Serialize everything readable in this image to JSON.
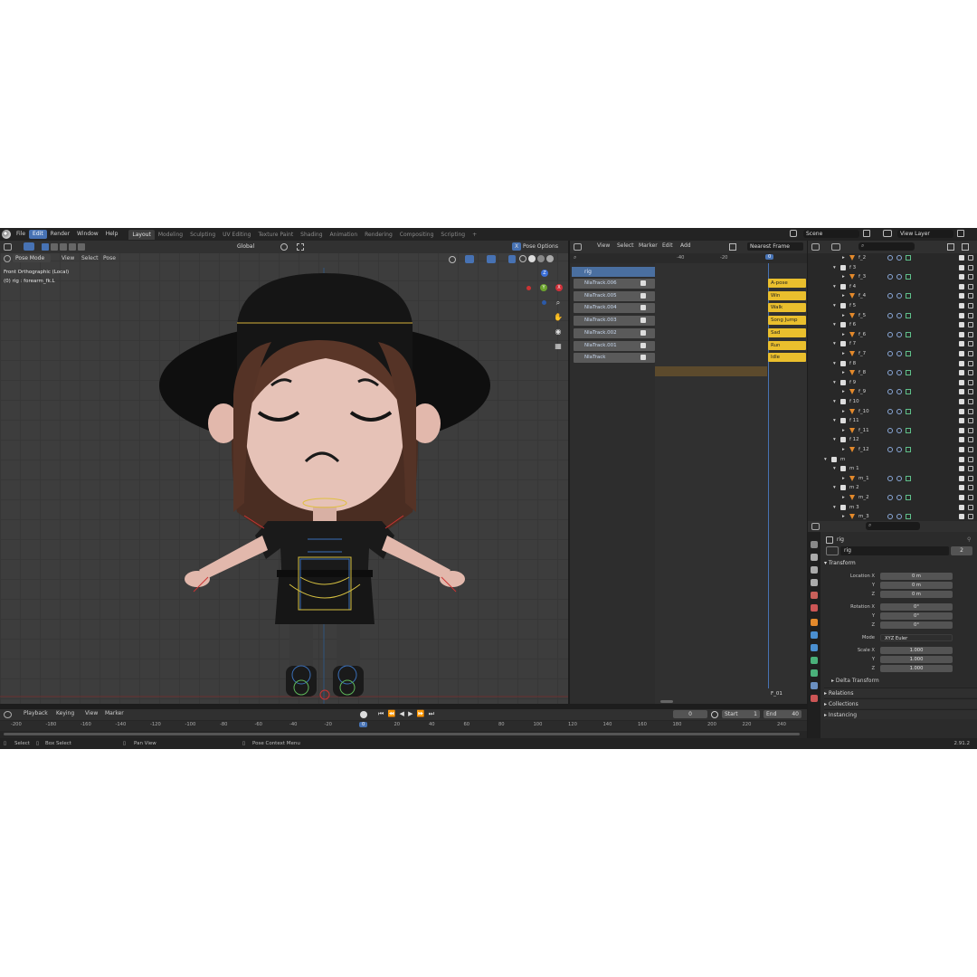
{
  "menubar": {
    "items": [
      "File",
      "Edit",
      "Render",
      "Window",
      "Help"
    ],
    "active": "Edit",
    "workspaces": [
      "Layout",
      "Modeling",
      "Sculpting",
      "UV Editing",
      "Texture Paint",
      "Shading",
      "Animation",
      "Rendering",
      "Compositing",
      "Scripting"
    ],
    "active_workspace": "Layout",
    "add_tab": "+",
    "scene": "Scene",
    "view_layer": "View Layer"
  },
  "viewport": {
    "mode": "Pose Mode",
    "menus": [
      "View",
      "Select",
      "Pose"
    ],
    "transform_orientation": "Global",
    "pose_options": "Pose Options",
    "x_label": "X",
    "view_name": "Front Orthographic (Local)",
    "object_info": "(0) rig : forearm_fk.L",
    "gizmo": {
      "y": "Y",
      "x": "X",
      "z": "Z"
    },
    "icons": [
      "zoom-icon",
      "hand-icon",
      "camera-icon",
      "grid-icon"
    ]
  },
  "nla": {
    "menus": [
      "View",
      "Select",
      "Marker",
      "Edit",
      "Add"
    ],
    "snap": "Nearest Frame",
    "ruler": [
      "-40",
      "-20",
      "0"
    ],
    "current_frame": "0",
    "rig_label": "rig",
    "tracks": [
      "NlaTrack.006",
      "NlaTrack.005",
      "NlaTrack.004",
      "NlaTrack.003",
      "NlaTrack.002",
      "NlaTrack.001",
      "NlaTrack"
    ],
    "strips": [
      "A-pose",
      "Win",
      "Walk",
      "Song Jump",
      "Sad",
      "Run",
      "Idle"
    ],
    "marker": "F_01"
  },
  "outliner": {
    "rows": [
      {
        "label": "f_2",
        "indent": 2
      },
      {
        "label": "f 3",
        "indent": 1
      },
      {
        "label": "f_3",
        "indent": 2
      },
      {
        "label": "f 4",
        "indent": 1
      },
      {
        "label": "f_4",
        "indent": 2
      },
      {
        "label": "f 5",
        "indent": 1
      },
      {
        "label": "f_5",
        "indent": 2
      },
      {
        "label": "f 6",
        "indent": 1
      },
      {
        "label": "f_6",
        "indent": 2
      },
      {
        "label": "f 7",
        "indent": 1
      },
      {
        "label": "f_7",
        "indent": 2
      },
      {
        "label": "f 8",
        "indent": 1
      },
      {
        "label": "f_8",
        "indent": 2
      },
      {
        "label": "f 9",
        "indent": 1
      },
      {
        "label": "f_9",
        "indent": 2
      },
      {
        "label": "f 10",
        "indent": 1
      },
      {
        "label": "f_10",
        "indent": 2
      },
      {
        "label": "f 11",
        "indent": 1
      },
      {
        "label": "f_11",
        "indent": 2
      },
      {
        "label": "f 12",
        "indent": 1
      },
      {
        "label": "f_12",
        "indent": 2
      },
      {
        "label": "m",
        "indent": 0
      },
      {
        "label": "m 1",
        "indent": 1
      },
      {
        "label": "m_1",
        "indent": 2
      },
      {
        "label": "m 2",
        "indent": 1
      },
      {
        "label": "m_2",
        "indent": 2
      },
      {
        "label": "m 3",
        "indent": 1
      },
      {
        "label": "m_3",
        "indent": 2
      }
    ]
  },
  "properties": {
    "header": "rig",
    "object_name": "rig",
    "users": "2",
    "transform_label": "Transform",
    "location": {
      "label": "Location X",
      "x": "0 m",
      "y": "0 m",
      "z": "0 m"
    },
    "rotation": {
      "label": "Rotation X",
      "x": "0°",
      "y": "0°",
      "z": "0°"
    },
    "mode_label": "Mode",
    "mode_value": "XYZ Euler",
    "scale": {
      "label": "Scale X",
      "x": "1.000",
      "y": "1.000",
      "z": "1.000"
    },
    "axis_y": "Y",
    "axis_z": "Z",
    "delta": "Delta Transform",
    "sections": [
      "Relations",
      "Collections",
      "Instancing"
    ]
  },
  "timeline": {
    "menus": [
      "Playback",
      "Keying",
      "View",
      "Marker"
    ],
    "frame": "0",
    "start_label": "Start",
    "start": "1",
    "end_label": "End",
    "end": "40",
    "ruler": [
      "-200",
      "-180",
      "-160",
      "-140",
      "-120",
      "-100",
      "-80",
      "-60",
      "-40",
      "-20",
      "0",
      "20",
      "40",
      "60",
      "80",
      "100",
      "120",
      "140",
      "160",
      "180",
      "200",
      "220",
      "240"
    ]
  },
  "statusbar": {
    "select": "Select",
    "box_select": "Box Select",
    "pan_view": "Pan View",
    "context_menu": "Pose Context Menu",
    "version": "2.91.2"
  },
  "colors": {
    "accent": "#4772b3",
    "strip": "#eabf2d",
    "playhead": "#4772b3"
  }
}
